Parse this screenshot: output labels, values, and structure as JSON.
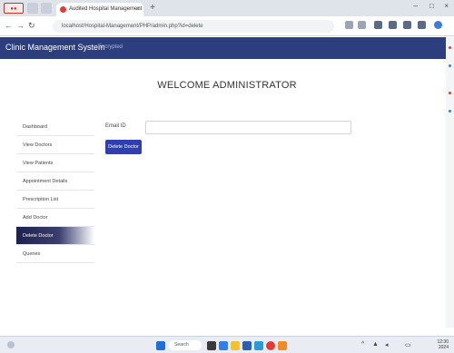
{
  "browser": {
    "tab_title": "Audited Hospital Management",
    "tab_close": "×",
    "new_tab": "+",
    "url": "localhost/Hospital-Management/PHP/admin.php?id=delete",
    "minimize": "–",
    "maximize": "□",
    "close": "×",
    "back": "←",
    "forward": "→",
    "reload": "↻"
  },
  "app": {
    "brand": "Clinic Management System",
    "brand_sub": "Encrypted"
  },
  "welcome": "WELCOME ADMINISTRATOR",
  "sidebar": {
    "items": [
      {
        "label": "Dashboard"
      },
      {
        "label": "View Doctors"
      },
      {
        "label": "View Patients"
      },
      {
        "label": "Appointment Details"
      },
      {
        "label": "Prescription List"
      },
      {
        "label": "Add Doctor"
      },
      {
        "label": "Delete Doctor"
      },
      {
        "label": "Queries"
      }
    ],
    "active_index": 6
  },
  "form": {
    "email_label": "Email ID",
    "email_value": "",
    "delete_button": "Delete Doctor"
  },
  "taskbar": {
    "search_label": "Search",
    "time": "12:30",
    "date": "2024"
  },
  "colors": {
    "header": "#2c3e7e",
    "button": "#2f3fb0",
    "active_item": "#1c2150"
  }
}
